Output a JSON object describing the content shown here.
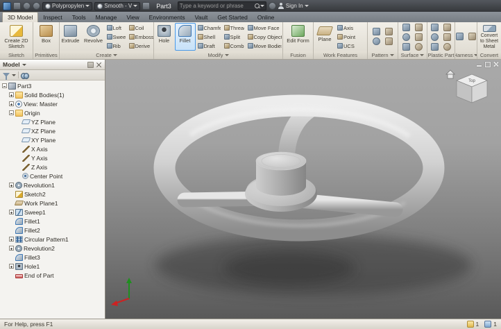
{
  "titlebar": {
    "material": "Polypropylen",
    "appearance": "Smooth - V",
    "doc_title": "Part3",
    "search_placeholder": "Type a keyword or phrase",
    "sign_in": "Sign In"
  },
  "tabs": [
    "3D Model",
    "Inspect",
    "Tools",
    "Manage",
    "View",
    "Environments",
    "Vault",
    "Get Started",
    "Online"
  ],
  "active_tab": 0,
  "ribbon": {
    "sketch": {
      "label": "Sketch",
      "create_2d_sketch": "Create 2D Sketch"
    },
    "primitives": {
      "label": "Primitives",
      "box": "Box"
    },
    "create": {
      "label": "Create",
      "extrude": "Extrude",
      "revolve": "Revolve",
      "small": [
        "Loft",
        "Coil",
        "Sweep",
        "Emboss",
        "Rib",
        "Derive"
      ]
    },
    "modify": {
      "label": "Modify",
      "hole": "Hole",
      "fillet": "Fillet",
      "small": [
        "Chamfer",
        "Thread",
        "Move Face",
        "Shell",
        "Split",
        "Copy Object",
        "Draft",
        "Combine",
        "Move Bodies"
      ]
    },
    "fusion": {
      "label": "Fusion",
      "edit_form": "Edit Form"
    },
    "work_features": {
      "label": "Work Features",
      "plane": "Plane",
      "small": [
        "Axis",
        "Point",
        "UCS"
      ]
    },
    "pattern": {
      "label": "Pattern",
      "icons": [
        "rectangular-pattern",
        "circular-pattern",
        "mirror",
        "sketch-driven-pattern"
      ]
    },
    "surface": {
      "label": "Surface",
      "icons": [
        "stitch",
        "patch",
        "trim",
        "extend",
        "sculpt",
        "replace-face"
      ]
    },
    "plastic_part": {
      "label": "Plastic Part",
      "icons": [
        "grill",
        "boss",
        "rest",
        "snap-fit",
        "rib-plastic",
        "lip"
      ]
    },
    "harness": {
      "label": "Harness",
      "icons": [
        "create-harness",
        "route"
      ]
    },
    "convert": {
      "label": "Convert",
      "convert_to_sheet_metal": "Convert to Sheet Metal"
    }
  },
  "browser": {
    "title": "Model",
    "tree": [
      {
        "label": "Part3",
        "level": 0,
        "exp": "-",
        "icon": "part"
      },
      {
        "label": "Solid Bodies(1)",
        "level": 1,
        "exp": "+",
        "icon": "folder"
      },
      {
        "label": "View: Master",
        "level": 1,
        "exp": "+",
        "icon": "view"
      },
      {
        "label": "Origin",
        "level": 1,
        "exp": "-",
        "icon": "folder"
      },
      {
        "label": "YZ Plane",
        "level": 2,
        "icon": "plane"
      },
      {
        "label": "XZ Plane",
        "level": 2,
        "icon": "plane"
      },
      {
        "label": "XY Plane",
        "level": 2,
        "icon": "plane"
      },
      {
        "label": "X Axis",
        "level": 2,
        "icon": "axis"
      },
      {
        "label": "Y Axis",
        "level": 2,
        "icon": "axis"
      },
      {
        "label": "Z Axis",
        "level": 2,
        "icon": "axis"
      },
      {
        "label": "Center Point",
        "level": 2,
        "icon": "point"
      },
      {
        "label": "Revolution1",
        "level": 1,
        "exp": "+",
        "icon": "revolve"
      },
      {
        "label": "Sketch2",
        "level": 1,
        "icon": "sketch"
      },
      {
        "label": "Work Plane1",
        "level": 1,
        "icon": "workplane"
      },
      {
        "label": "Sweep1",
        "level": 1,
        "exp": "+",
        "icon": "sweep"
      },
      {
        "label": "Fillet1",
        "level": 1,
        "icon": "fillet"
      },
      {
        "label": "Fillet2",
        "level": 1,
        "icon": "fillet"
      },
      {
        "label": "Circular Pattern1",
        "level": 1,
        "exp": "+",
        "icon": "pattern"
      },
      {
        "label": "Revolution2",
        "level": 1,
        "exp": "+",
        "icon": "revolve"
      },
      {
        "label": "Fillet3",
        "level": 1,
        "icon": "fillet"
      },
      {
        "label": "Hole1",
        "level": 1,
        "exp": "+",
        "icon": "hole"
      },
      {
        "label": "End of Part",
        "level": 1,
        "icon": "eop"
      }
    ]
  },
  "viewport": {
    "viewcube_top": "Top"
  },
  "statusbar": {
    "help": "For Help, press F1",
    "count1": "1",
    "count2": "1"
  },
  "colors": {
    "highlight": "#4a9ae8",
    "viewport_top": "#a9a9a9",
    "viewport_bottom": "#595959"
  }
}
